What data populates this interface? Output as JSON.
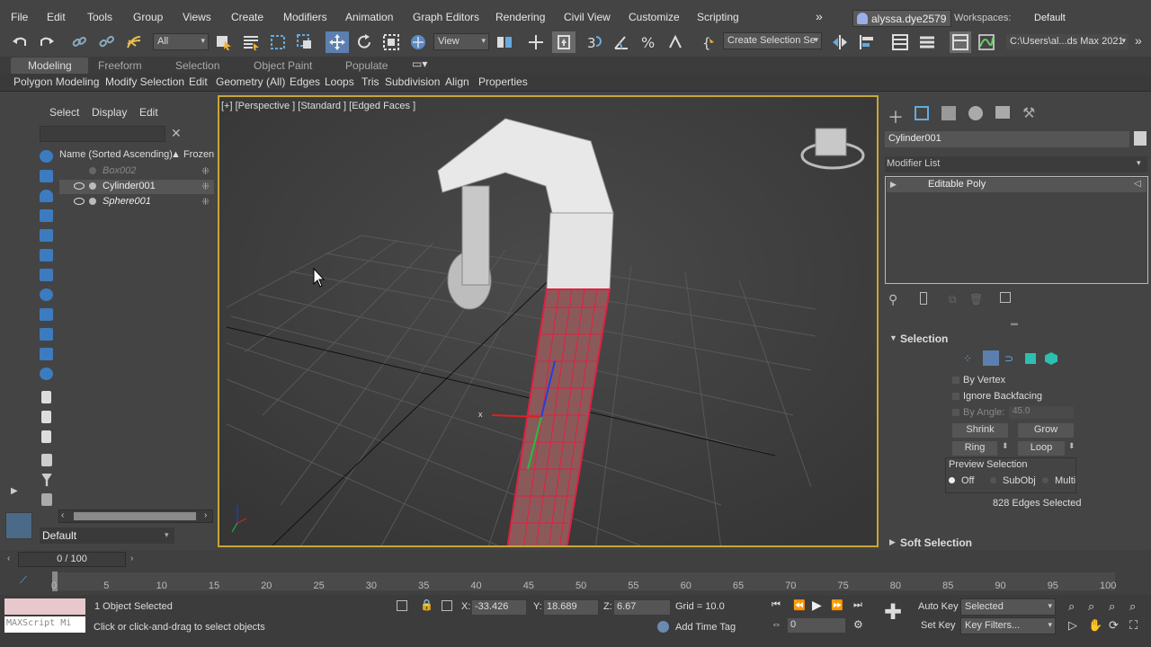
{
  "menu": {
    "items": [
      "File",
      "Edit",
      "Tools",
      "Group",
      "Views",
      "Create",
      "Modifiers",
      "Animation",
      "Graph Editors",
      "Rendering",
      "Civil View",
      "Customize",
      "Scripting"
    ],
    "overflow": "»",
    "user": "alyssa.dye2579",
    "workspaces_label": "Workspaces:",
    "workspace_value": "Default"
  },
  "toolbar": {
    "selection_filter": "All",
    "ref_coord": "View",
    "named_selection": "Create Selection Se",
    "project_path": "C:\\Users\\al...ds Max 2021"
  },
  "ribbon": {
    "tabs": [
      "Modeling",
      "Freeform",
      "Selection",
      "Object Paint",
      "Populate"
    ],
    "sub_items": [
      "Polygon Modeling",
      "Modify Selection",
      "Edit",
      "Geometry (All)",
      "Edges",
      "Loops",
      "Tris",
      "Subdivision",
      "Align",
      "Properties"
    ]
  },
  "scene_explorer": {
    "tabs": [
      "Select",
      "Display",
      "Edit"
    ],
    "col_name": "Name (Sorted Ascending)",
    "col_frozen": "▲ Frozen",
    "objects": [
      {
        "name": "Box002",
        "hidden": true,
        "selected": false
      },
      {
        "name": "Cylinder001",
        "hidden": false,
        "selected": true
      },
      {
        "name": "Sphere001",
        "hidden": false,
        "selected": false
      }
    ],
    "layer": "Default"
  },
  "viewport": {
    "label": "[+] [Perspective ] [Standard ] [Edged Faces ]"
  },
  "command_panel": {
    "object_name": "Cylinder001",
    "modifier_list": "Modifier List",
    "stack_item": "Editable Poly",
    "selection_title": "Selection",
    "by_vertex": "By Vertex",
    "ignore_backfacing": "Ignore Backfacing",
    "by_angle": "By Angle:",
    "angle_value": "45.0",
    "shrink": "Shrink",
    "grow": "Grow",
    "ring": "Ring",
    "loop": "Loop",
    "preview_selection": "Preview Selection",
    "preview_off": "Off",
    "preview_subobj": "SubObj",
    "preview_multi": "Multi",
    "edges_selected": "828 Edges Selected",
    "soft_selection": "Soft Selection"
  },
  "timeline": {
    "frame": "0 / 100",
    "ticks": [
      "0",
      "5",
      "10",
      "15",
      "20",
      "25",
      "30",
      "35",
      "40",
      "45",
      "50",
      "55",
      "60",
      "65",
      "70",
      "75",
      "80",
      "85",
      "90",
      "95",
      "100"
    ]
  },
  "status": {
    "maxscript": "MAXScript Mi",
    "objects_selected": "1 Object Selected",
    "prompt": "Click or click-and-drag to select objects",
    "x_label": "X:",
    "x": "-33.426",
    "y_label": "Y:",
    "y": "18.689",
    "z_label": "Z:",
    "z": "6.67",
    "grid": "Grid = 10.0",
    "add_time_tag": "Add Time Tag",
    "current_frame": "0",
    "auto_key": "Auto Key",
    "set_key": "Set Key",
    "selected": "Selected",
    "key_filters": "Key Filters..."
  }
}
